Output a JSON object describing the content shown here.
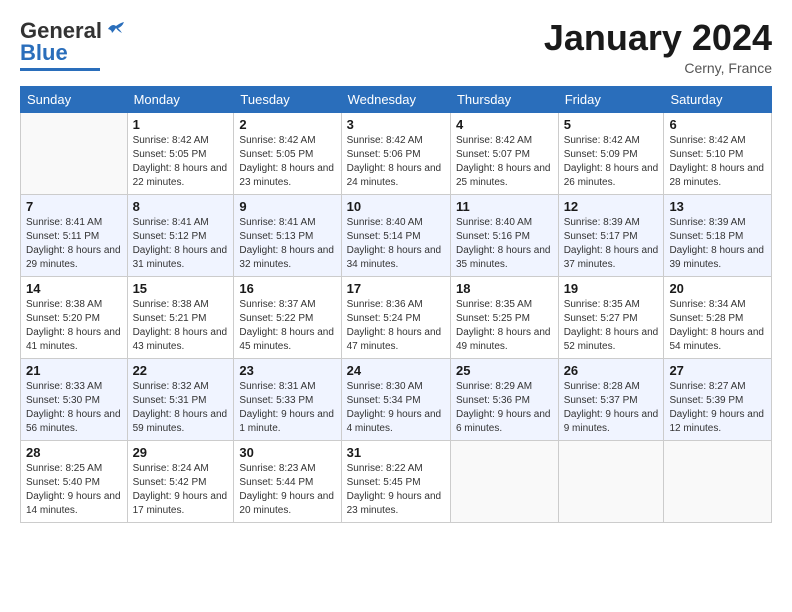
{
  "header": {
    "logo_general": "General",
    "logo_blue": "Blue",
    "month_title": "January 2024",
    "location": "Cerny, France"
  },
  "days_of_week": [
    "Sunday",
    "Monday",
    "Tuesday",
    "Wednesday",
    "Thursday",
    "Friday",
    "Saturday"
  ],
  "weeks": [
    [
      {
        "day": "",
        "sunrise": "",
        "sunset": "",
        "daylight": ""
      },
      {
        "day": "1",
        "sunrise": "Sunrise: 8:42 AM",
        "sunset": "Sunset: 5:05 PM",
        "daylight": "Daylight: 8 hours and 22 minutes."
      },
      {
        "day": "2",
        "sunrise": "Sunrise: 8:42 AM",
        "sunset": "Sunset: 5:05 PM",
        "daylight": "Daylight: 8 hours and 23 minutes."
      },
      {
        "day": "3",
        "sunrise": "Sunrise: 8:42 AM",
        "sunset": "Sunset: 5:06 PM",
        "daylight": "Daylight: 8 hours and 24 minutes."
      },
      {
        "day": "4",
        "sunrise": "Sunrise: 8:42 AM",
        "sunset": "Sunset: 5:07 PM",
        "daylight": "Daylight: 8 hours and 25 minutes."
      },
      {
        "day": "5",
        "sunrise": "Sunrise: 8:42 AM",
        "sunset": "Sunset: 5:09 PM",
        "daylight": "Daylight: 8 hours and 26 minutes."
      },
      {
        "day": "6",
        "sunrise": "Sunrise: 8:42 AM",
        "sunset": "Sunset: 5:10 PM",
        "daylight": "Daylight: 8 hours and 28 minutes."
      }
    ],
    [
      {
        "day": "7",
        "sunrise": "Sunrise: 8:41 AM",
        "sunset": "Sunset: 5:11 PM",
        "daylight": "Daylight: 8 hours and 29 minutes."
      },
      {
        "day": "8",
        "sunrise": "Sunrise: 8:41 AM",
        "sunset": "Sunset: 5:12 PM",
        "daylight": "Daylight: 8 hours and 31 minutes."
      },
      {
        "day": "9",
        "sunrise": "Sunrise: 8:41 AM",
        "sunset": "Sunset: 5:13 PM",
        "daylight": "Daylight: 8 hours and 32 minutes."
      },
      {
        "day": "10",
        "sunrise": "Sunrise: 8:40 AM",
        "sunset": "Sunset: 5:14 PM",
        "daylight": "Daylight: 8 hours and 34 minutes."
      },
      {
        "day": "11",
        "sunrise": "Sunrise: 8:40 AM",
        "sunset": "Sunset: 5:16 PM",
        "daylight": "Daylight: 8 hours and 35 minutes."
      },
      {
        "day": "12",
        "sunrise": "Sunrise: 8:39 AM",
        "sunset": "Sunset: 5:17 PM",
        "daylight": "Daylight: 8 hours and 37 minutes."
      },
      {
        "day": "13",
        "sunrise": "Sunrise: 8:39 AM",
        "sunset": "Sunset: 5:18 PM",
        "daylight": "Daylight: 8 hours and 39 minutes."
      }
    ],
    [
      {
        "day": "14",
        "sunrise": "Sunrise: 8:38 AM",
        "sunset": "Sunset: 5:20 PM",
        "daylight": "Daylight: 8 hours and 41 minutes."
      },
      {
        "day": "15",
        "sunrise": "Sunrise: 8:38 AM",
        "sunset": "Sunset: 5:21 PM",
        "daylight": "Daylight: 8 hours and 43 minutes."
      },
      {
        "day": "16",
        "sunrise": "Sunrise: 8:37 AM",
        "sunset": "Sunset: 5:22 PM",
        "daylight": "Daylight: 8 hours and 45 minutes."
      },
      {
        "day": "17",
        "sunrise": "Sunrise: 8:36 AM",
        "sunset": "Sunset: 5:24 PM",
        "daylight": "Daylight: 8 hours and 47 minutes."
      },
      {
        "day": "18",
        "sunrise": "Sunrise: 8:35 AM",
        "sunset": "Sunset: 5:25 PM",
        "daylight": "Daylight: 8 hours and 49 minutes."
      },
      {
        "day": "19",
        "sunrise": "Sunrise: 8:35 AM",
        "sunset": "Sunset: 5:27 PM",
        "daylight": "Daylight: 8 hours and 52 minutes."
      },
      {
        "day": "20",
        "sunrise": "Sunrise: 8:34 AM",
        "sunset": "Sunset: 5:28 PM",
        "daylight": "Daylight: 8 hours and 54 minutes."
      }
    ],
    [
      {
        "day": "21",
        "sunrise": "Sunrise: 8:33 AM",
        "sunset": "Sunset: 5:30 PM",
        "daylight": "Daylight: 8 hours and 56 minutes."
      },
      {
        "day": "22",
        "sunrise": "Sunrise: 8:32 AM",
        "sunset": "Sunset: 5:31 PM",
        "daylight": "Daylight: 8 hours and 59 minutes."
      },
      {
        "day": "23",
        "sunrise": "Sunrise: 8:31 AM",
        "sunset": "Sunset: 5:33 PM",
        "daylight": "Daylight: 9 hours and 1 minute."
      },
      {
        "day": "24",
        "sunrise": "Sunrise: 8:30 AM",
        "sunset": "Sunset: 5:34 PM",
        "daylight": "Daylight: 9 hours and 4 minutes."
      },
      {
        "day": "25",
        "sunrise": "Sunrise: 8:29 AM",
        "sunset": "Sunset: 5:36 PM",
        "daylight": "Daylight: 9 hours and 6 minutes."
      },
      {
        "day": "26",
        "sunrise": "Sunrise: 8:28 AM",
        "sunset": "Sunset: 5:37 PM",
        "daylight": "Daylight: 9 hours and 9 minutes."
      },
      {
        "day": "27",
        "sunrise": "Sunrise: 8:27 AM",
        "sunset": "Sunset: 5:39 PM",
        "daylight": "Daylight: 9 hours and 12 minutes."
      }
    ],
    [
      {
        "day": "28",
        "sunrise": "Sunrise: 8:25 AM",
        "sunset": "Sunset: 5:40 PM",
        "daylight": "Daylight: 9 hours and 14 minutes."
      },
      {
        "day": "29",
        "sunrise": "Sunrise: 8:24 AM",
        "sunset": "Sunset: 5:42 PM",
        "daylight": "Daylight: 9 hours and 17 minutes."
      },
      {
        "day": "30",
        "sunrise": "Sunrise: 8:23 AM",
        "sunset": "Sunset: 5:44 PM",
        "daylight": "Daylight: 9 hours and 20 minutes."
      },
      {
        "day": "31",
        "sunrise": "Sunrise: 8:22 AM",
        "sunset": "Sunset: 5:45 PM",
        "daylight": "Daylight: 9 hours and 23 minutes."
      },
      {
        "day": "",
        "sunrise": "",
        "sunset": "",
        "daylight": ""
      },
      {
        "day": "",
        "sunrise": "",
        "sunset": "",
        "daylight": ""
      },
      {
        "day": "",
        "sunrise": "",
        "sunset": "",
        "daylight": ""
      }
    ]
  ]
}
